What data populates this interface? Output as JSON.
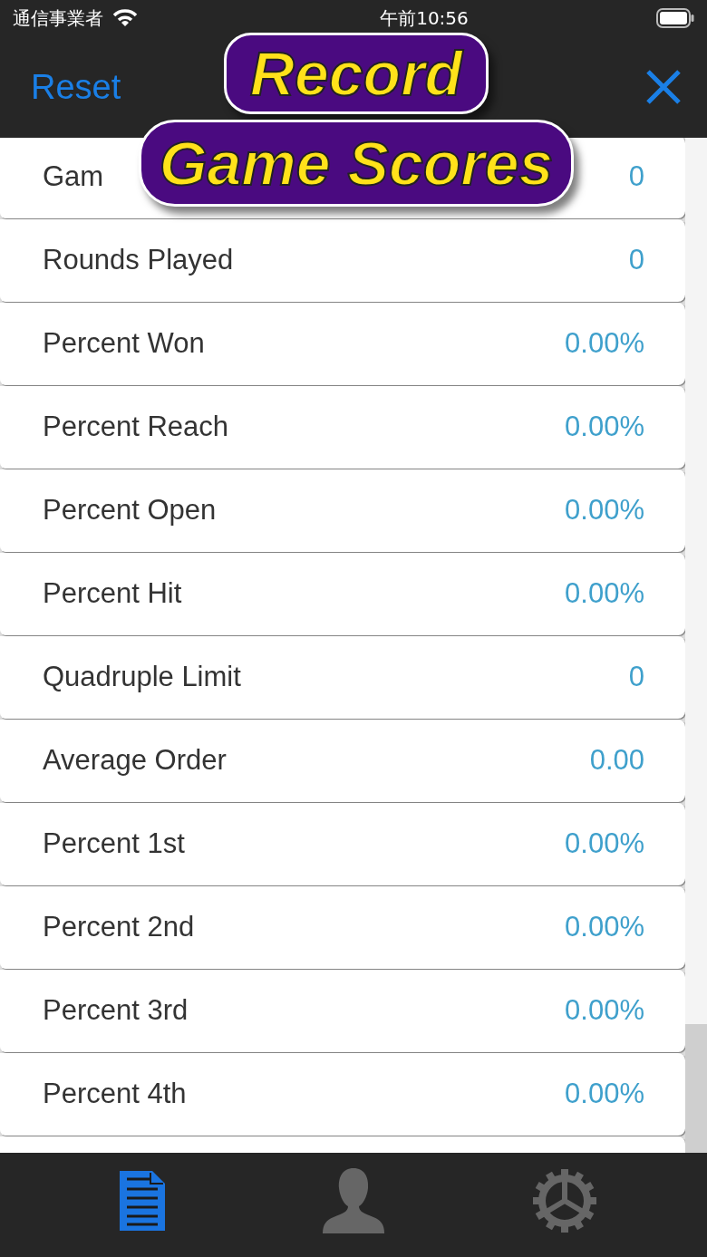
{
  "status_bar": {
    "carrier": "通信事業者",
    "time": "午前10:56"
  },
  "nav_bar": {
    "left_button": "Reset"
  },
  "banner": {
    "line_1": "Record",
    "line_2": "Game Scores"
  },
  "stats": [
    {
      "label": "Gam",
      "value": "0"
    },
    {
      "label": "Rounds Played",
      "value": "0"
    },
    {
      "label": "Percent Won",
      "value": "0.00%"
    },
    {
      "label": "Percent Reach",
      "value": "0.00%"
    },
    {
      "label": "Percent Open",
      "value": "0.00%"
    },
    {
      "label": "Percent Hit",
      "value": "0.00%"
    },
    {
      "label": "Quadruple Limit",
      "value": "0"
    },
    {
      "label": "Average Order",
      "value": "0.00"
    },
    {
      "label": "Percent 1st",
      "value": "0.00%"
    },
    {
      "label": "Percent 2nd",
      "value": "0.00%"
    },
    {
      "label": "Percent 3rd",
      "value": "0.00%"
    },
    {
      "label": "Percent 4th",
      "value": "0.00%"
    }
  ],
  "tab_bar": [
    {
      "kind": "document",
      "selected": true
    },
    {
      "kind": "person",
      "selected": false
    },
    {
      "kind": "gear",
      "selected": false
    }
  ]
}
